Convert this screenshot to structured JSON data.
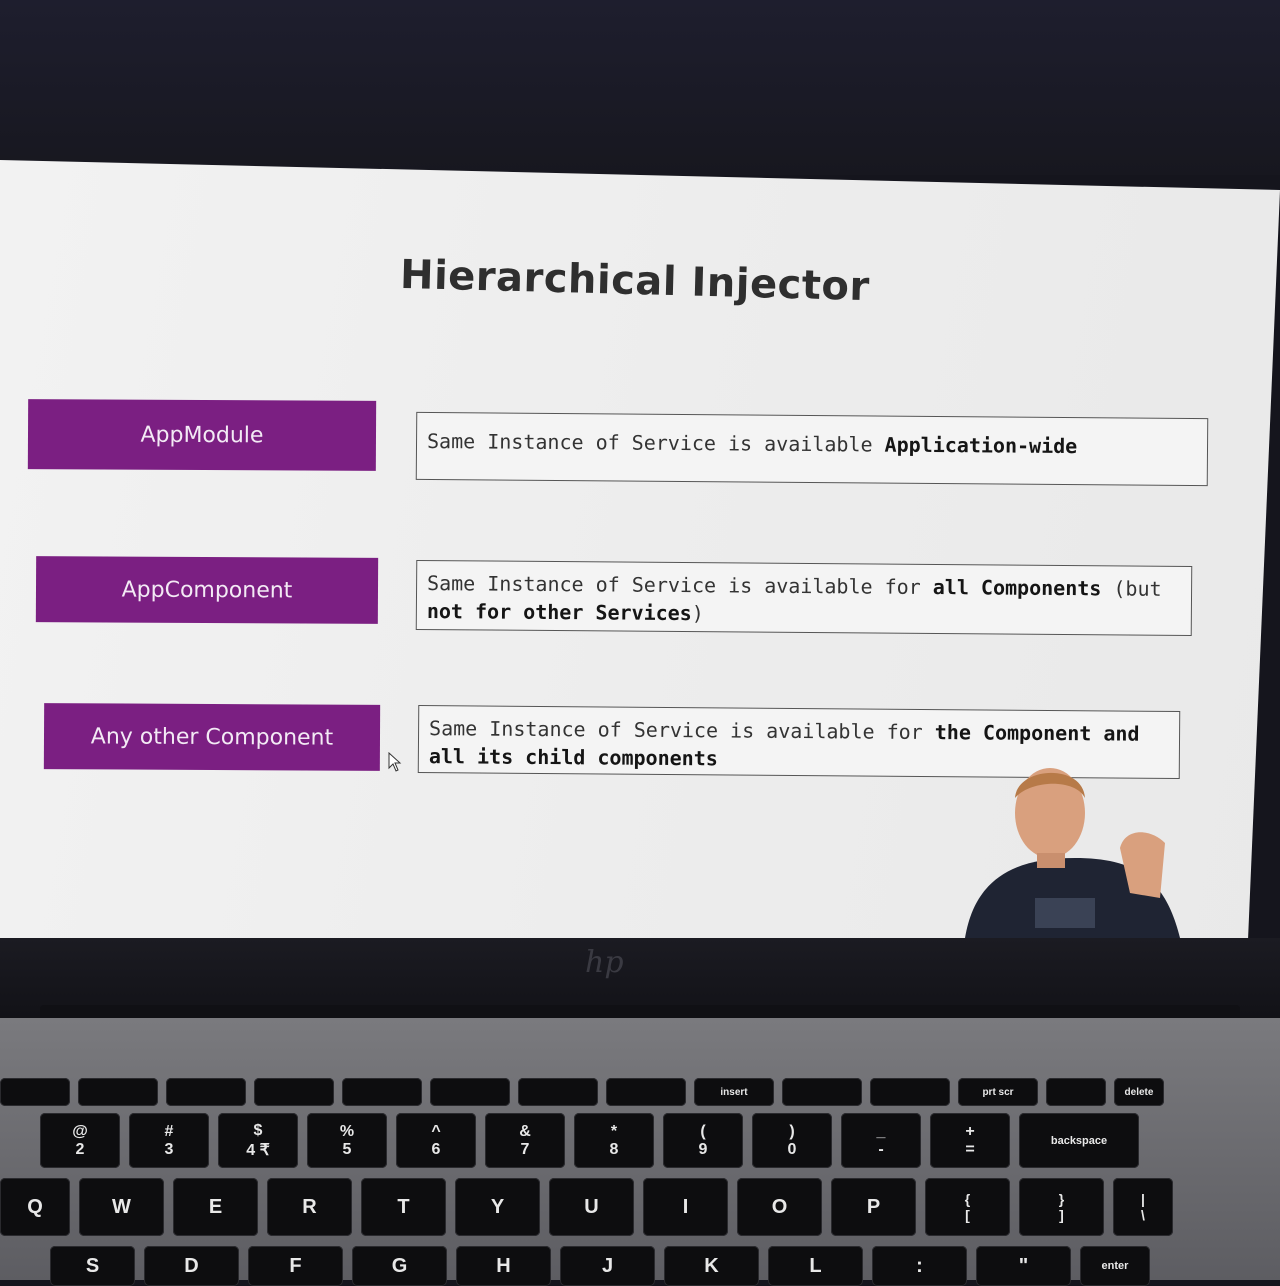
{
  "slide": {
    "title": "Hierarchical Injector",
    "rows": [
      {
        "label": "AppModule",
        "text_normal": "Same Instance of Service is available ",
        "text_bold": "Application-wide"
      },
      {
        "label": "AppComponent",
        "text_a": "Same Instance of Service is available for ",
        "text_b": "all Components",
        "text_c": " (but ",
        "text_d": "not for other Services",
        "text_e": ")"
      },
      {
        "label": "Any other Component",
        "text_a": "Same Instance of Service is available for ",
        "text_b": "the Component and all its child components"
      }
    ]
  },
  "laptop": {
    "logo": "hp"
  },
  "keyboard": {
    "fn_row": [
      "",
      "",
      "",
      "",
      "",
      "",
      "",
      "",
      "insert",
      "",
      "",
      "prt scr",
      "",
      "delete"
    ],
    "num_row": [
      "@\n2",
      "#\n3",
      "$\n4 ₹",
      "%\n5",
      "^\n6",
      "&\n7",
      "*\n8",
      "(\n9",
      ")\n0",
      "_\n-",
      "+\n=",
      "backspace"
    ],
    "q_row": [
      "Q",
      "W",
      "E",
      "R",
      "T",
      "Y",
      "U",
      "I",
      "O",
      "P",
      "{\n[",
      "}\n]",
      "|\n\\"
    ],
    "a_row": [
      "S",
      "D",
      "F",
      "G",
      "H",
      "J",
      "K",
      "L",
      ":",
      "\"",
      "enter"
    ]
  },
  "colors": {
    "accent": "#7b1f82",
    "slide_bg": "#efefef",
    "title": "#2f2f2f"
  }
}
